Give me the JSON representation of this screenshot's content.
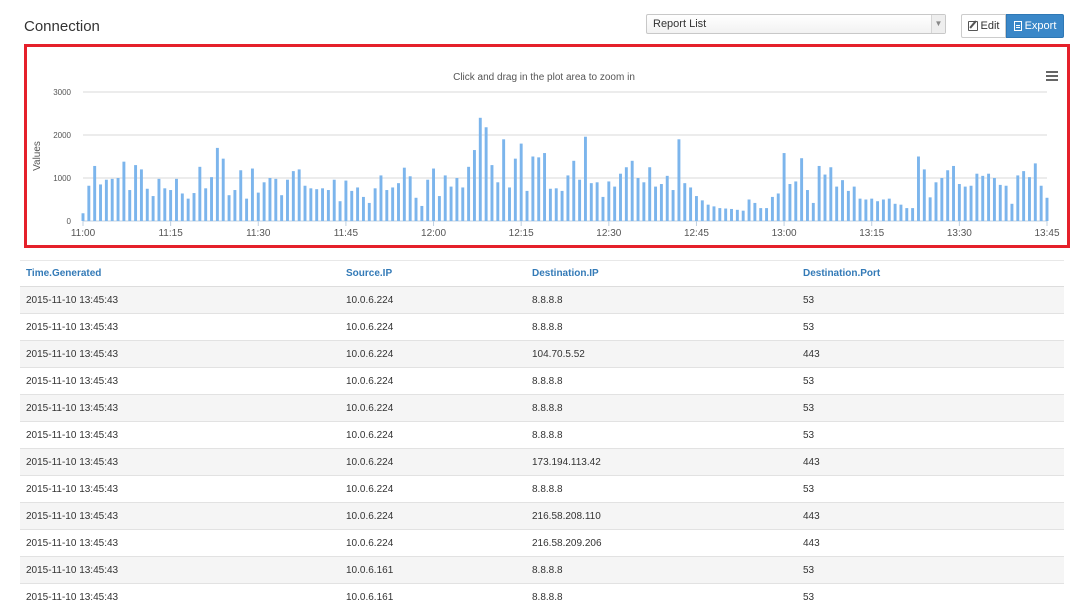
{
  "page": {
    "title": "Connection"
  },
  "toolbar": {
    "report_select_value": "Report List",
    "edit_label": "Edit",
    "export_label": "Export"
  },
  "chart_data": {
    "type": "bar",
    "subtitle": "Click and drag in the plot area to zoom in",
    "ylabel": "Values",
    "ylim": [
      0,
      3000
    ],
    "yticks": [
      "0",
      "1000",
      "2000",
      "3000"
    ],
    "xticks": [
      "11:00",
      "11:15",
      "11:30",
      "11:45",
      "12:00",
      "12:15",
      "12:30",
      "12:45",
      "13:00",
      "13:15",
      "13:30",
      "13:45"
    ],
    "x_range_minutes": [
      0,
      165
    ],
    "bar_interval_minutes": 1,
    "grid": true,
    "color": "#7cb5ec",
    "values": [
      180,
      820,
      1280,
      850,
      960,
      980,
      1000,
      1380,
      720,
      1300,
      1200,
      750,
      580,
      980,
      760,
      720,
      980,
      640,
      520,
      650,
      1260,
      760,
      1020,
      1700,
      1450,
      600,
      720,
      1180,
      520,
      1220,
      660,
      900,
      1000,
      980,
      600,
      960,
      1160,
      1200,
      820,
      760,
      740,
      760,
      720,
      960,
      460,
      940,
      700,
      780,
      560,
      420,
      760,
      1060,
      720,
      780,
      880,
      1240,
      1040,
      540,
      350,
      960,
      1220,
      580,
      1060,
      800,
      1000,
      780,
      1260,
      1650,
      2400,
      2180,
      1300,
      900,
      1900,
      780,
      1450,
      1800,
      700,
      1500,
      1480,
      1580,
      750,
      760,
      700,
      1060,
      1400,
      960,
      1960,
      880,
      900,
      560,
      920,
      800,
      1100,
      1250,
      1400,
      1000,
      900,
      1250,
      800,
      860,
      1050,
      720,
      1900,
      880,
      780,
      580,
      480,
      380,
      340,
      300,
      290,
      280,
      260,
      240,
      500,
      420,
      300,
      300,
      560,
      640,
      1580,
      860,
      920,
      1460,
      720,
      420,
      1280,
      1080,
      1250,
      800,
      950,
      700,
      800,
      520,
      500,
      520,
      460,
      500,
      520,
      400,
      380,
      300,
      300,
      1500,
      1200,
      550,
      900,
      1000,
      1180,
      1280,
      860,
      800,
      820,
      1100,
      1050,
      1100,
      1000,
      840,
      820,
      400,
      1060,
      1160,
      1020,
      1340,
      820,
      540
    ]
  },
  "table": {
    "columns": [
      "Time.Generated",
      "Source.IP",
      "Destination.IP",
      "Destination.Port"
    ],
    "rows": [
      [
        "2015-11-10 13:45:43",
        "10.0.6.224",
        "8.8.8.8",
        "53"
      ],
      [
        "2015-11-10 13:45:43",
        "10.0.6.224",
        "8.8.8.8",
        "53"
      ],
      [
        "2015-11-10 13:45:43",
        "10.0.6.224",
        "104.70.5.52",
        "443"
      ],
      [
        "2015-11-10 13:45:43",
        "10.0.6.224",
        "8.8.8.8",
        "53"
      ],
      [
        "2015-11-10 13:45:43",
        "10.0.6.224",
        "8.8.8.8",
        "53"
      ],
      [
        "2015-11-10 13:45:43",
        "10.0.6.224",
        "8.8.8.8",
        "53"
      ],
      [
        "2015-11-10 13:45:43",
        "10.0.6.224",
        "173.194.113.42",
        "443"
      ],
      [
        "2015-11-10 13:45:43",
        "10.0.6.224",
        "8.8.8.8",
        "53"
      ],
      [
        "2015-11-10 13:45:43",
        "10.0.6.224",
        "216.58.208.110",
        "443"
      ],
      [
        "2015-11-10 13:45:43",
        "10.0.6.224",
        "216.58.209.206",
        "443"
      ],
      [
        "2015-11-10 13:45:43",
        "10.0.6.161",
        "8.8.8.8",
        "53"
      ],
      [
        "2015-11-10 13:45:43",
        "10.0.6.161",
        "8.8.8.8",
        "53"
      ]
    ]
  }
}
